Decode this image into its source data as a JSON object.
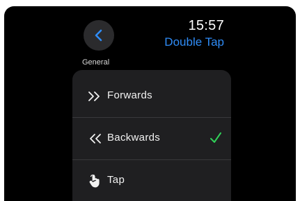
{
  "header": {
    "back_icon": "chevron-left-icon",
    "time": "15:57",
    "title": "Double Tap"
  },
  "section": {
    "label": "General"
  },
  "options": [
    {
      "label": "Forwards",
      "icon": "double-chevron-right-icon",
      "selected": false
    },
    {
      "label": "Backwards",
      "icon": "double-chevron-left-icon",
      "selected": true
    },
    {
      "label": "Tap",
      "icon": "hand-tap-icon",
      "selected": false
    }
  ],
  "colors": {
    "accent": "#2f8cf6",
    "check": "#30d158",
    "background": "#000000",
    "list_background": "#1f1f21"
  }
}
